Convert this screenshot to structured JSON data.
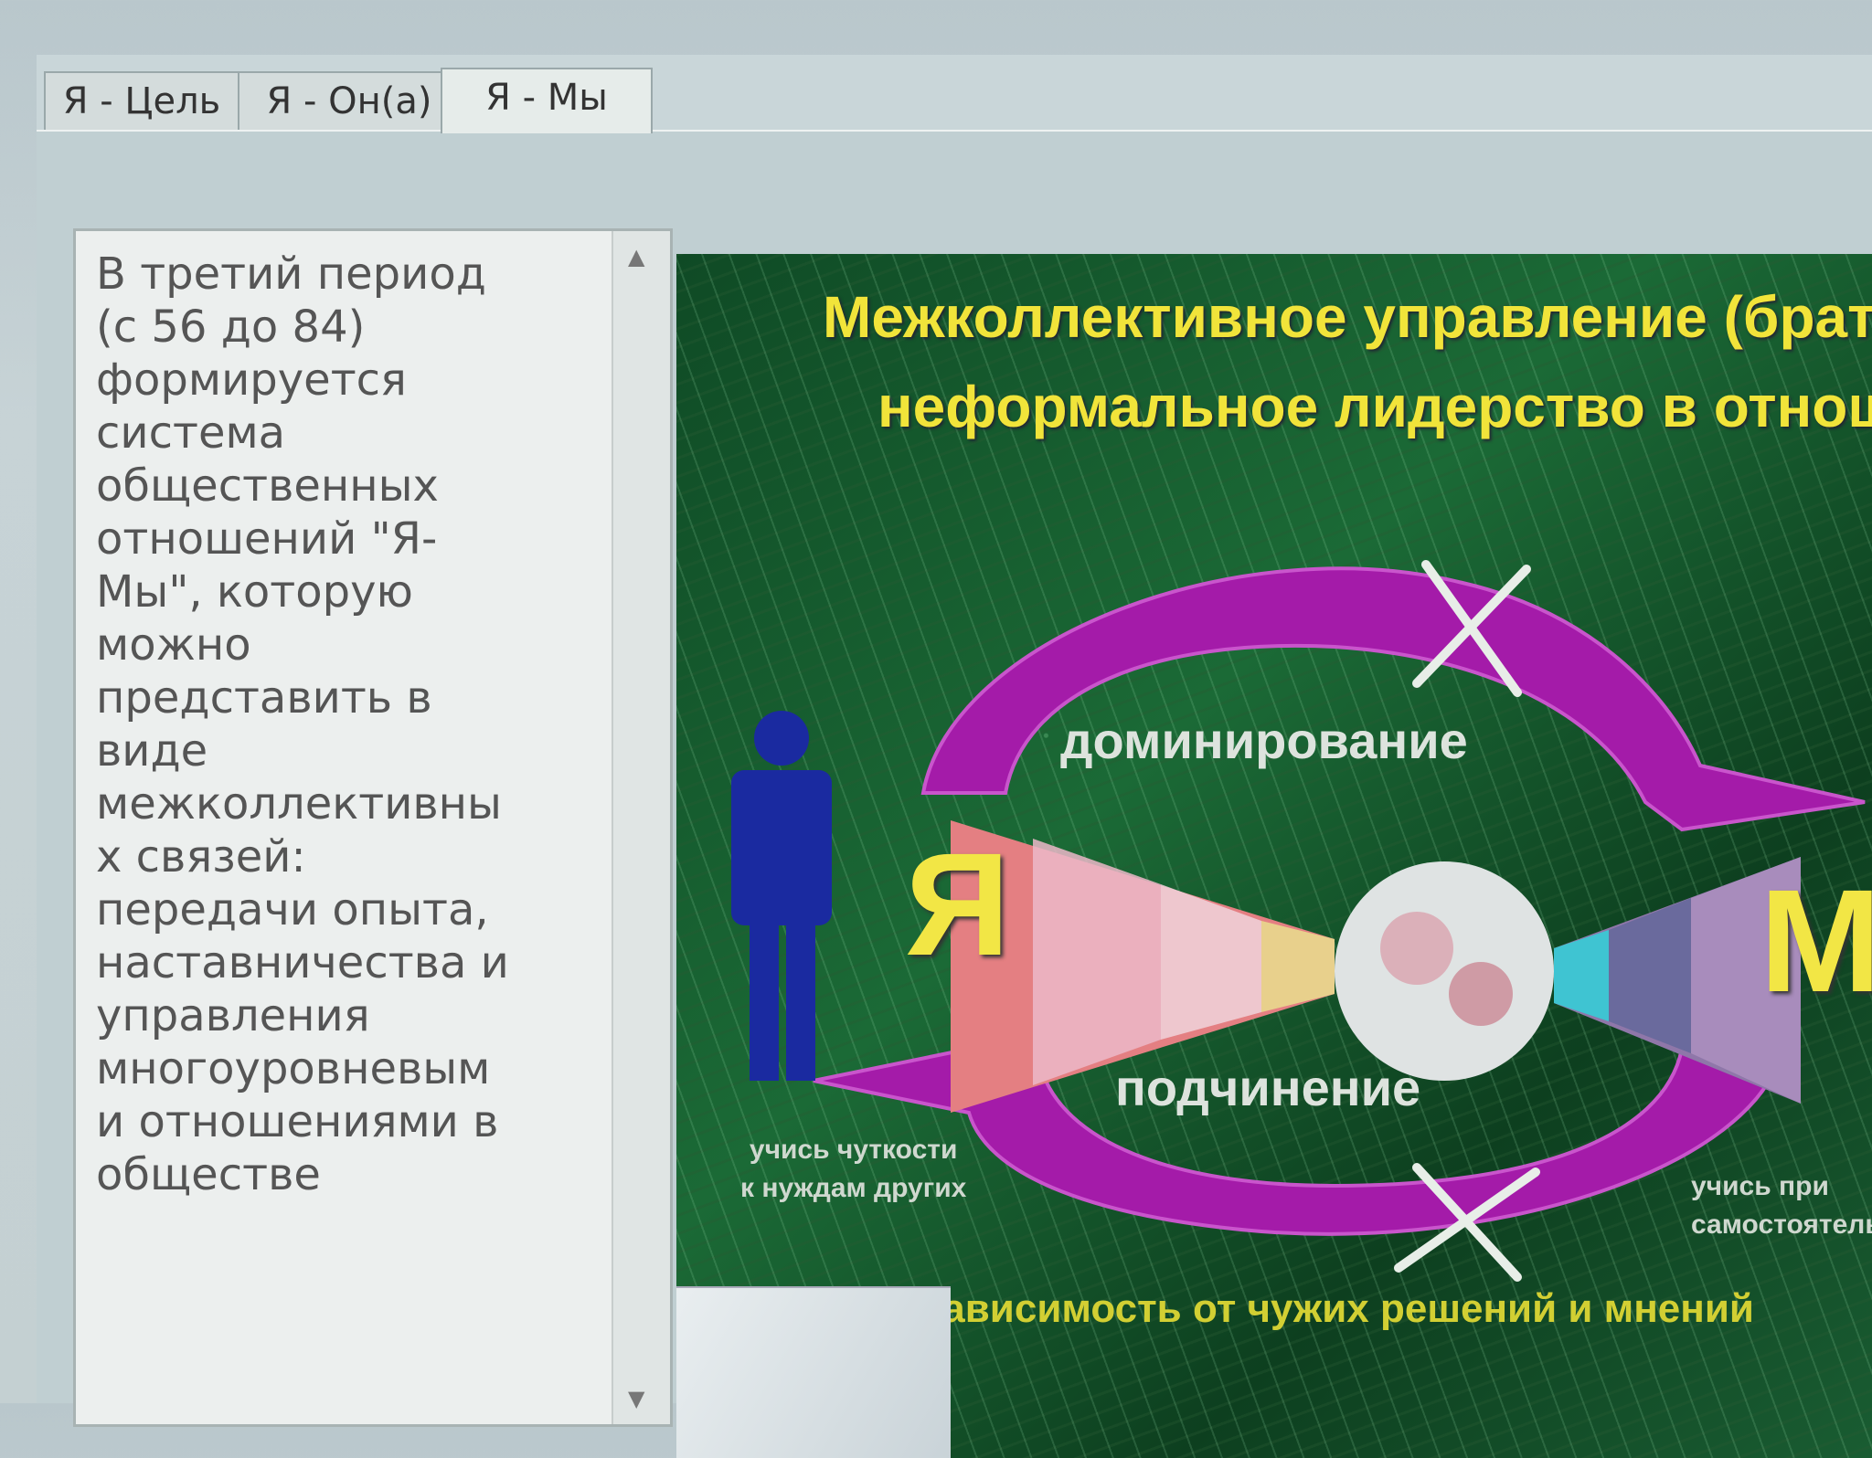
{
  "tabs": [
    {
      "label": "Я - Цель"
    },
    {
      "label": "Я - Он(а)"
    },
    {
      "label": "Я - Мы",
      "selected": true
    }
  ],
  "description": {
    "text": "В третий период\n(с 56 до 84)\nформируется\nсистема\nобщественных\nотношений \"Я-\nМы\", которую\nможно\nпредставить в\nвиде\nмежколлективны\nх связей:\nпередачи опыта,\nнаставничества и\nуправления\nмногоуровневым\nи отношениями в\nобществе"
  },
  "slide": {
    "title_line1": "Межколлективное управление (брат -",
    "title_line2": "неформальное лидерство в отноше",
    "left_letter": "Я",
    "right_letter": "Мы",
    "top_arrow_label": "доминирование",
    "bottom_arrow_label": "подчинение",
    "left_note": "учись чуткости\nк нуждам других",
    "right_note": "учись при\nсамостоятельн",
    "bottom_caption": "зависимость от чужих решений и мнений"
  },
  "colors": {
    "slide_title": "#f1e43a",
    "arrows": "#a21aa8",
    "person": "#1a2aa0"
  },
  "icons": {
    "left_figure": "person-icon",
    "top_cross": "cross-icon",
    "bottom_cross": "cross-icon"
  }
}
